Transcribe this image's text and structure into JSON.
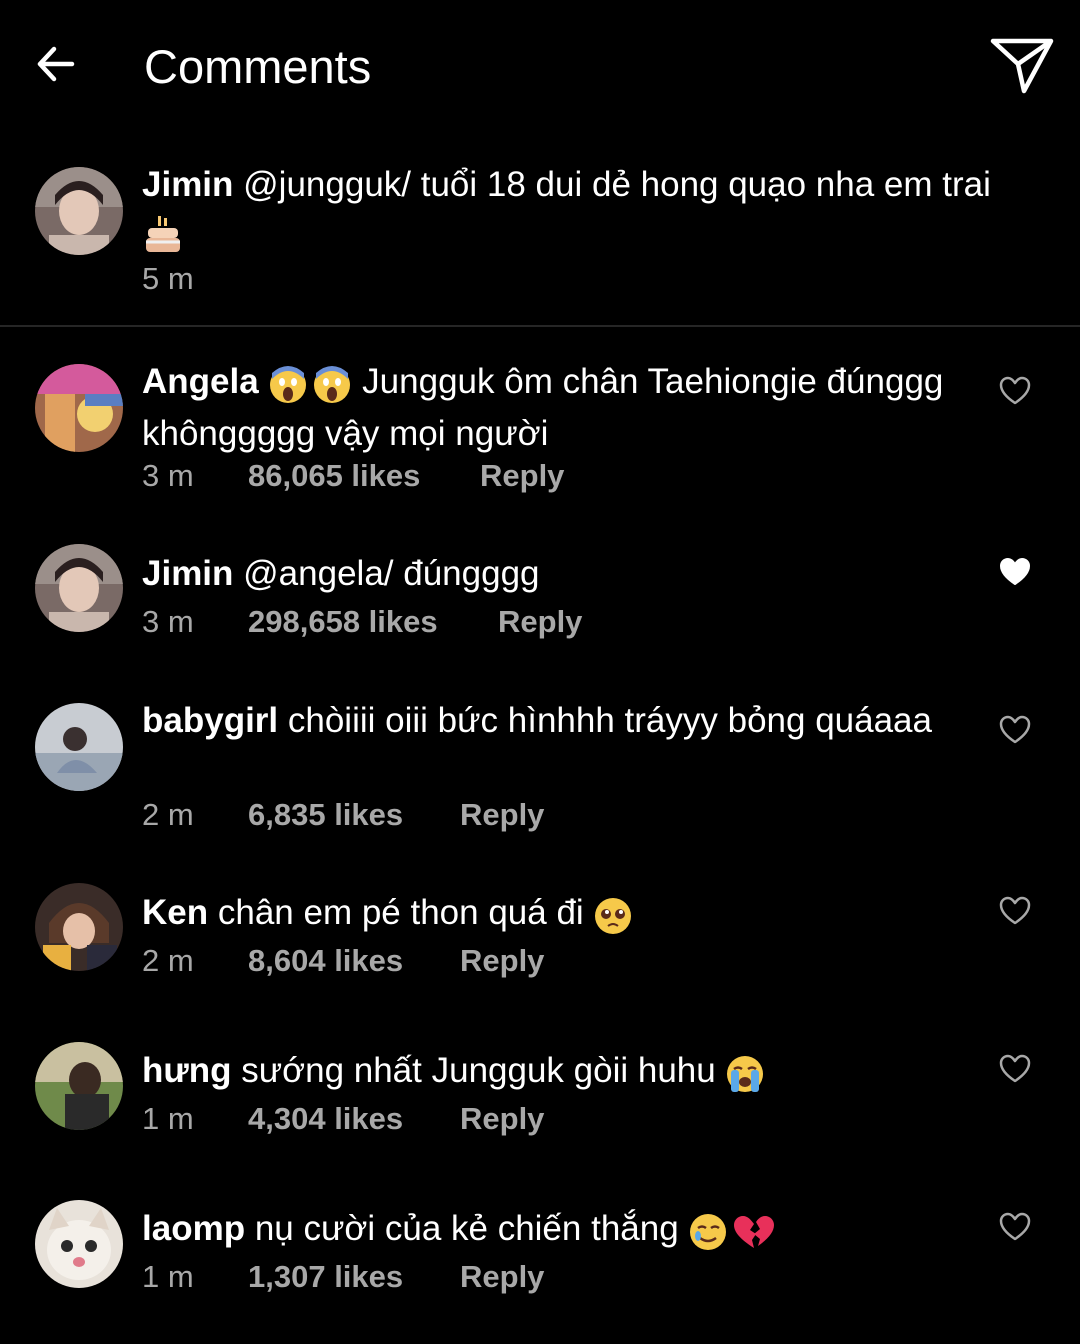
{
  "header": {
    "title": "Comments",
    "back_icon": "arrow-left-icon",
    "send_icon": "paper-plane-icon"
  },
  "caption": {
    "username": "Jimin",
    "text": "@jungguk/ tuổi 18 dui dẻ hong quạo nha em trai",
    "emoji": "🎂",
    "time": "5 m"
  },
  "comments": [
    {
      "username": "Angela",
      "lead_emoji": "😱😱",
      "text": "Jungguk ôm chân Taehiongie đúnggg khônggggg vậy mọi người",
      "time": "3 m",
      "likes": "86,065 likes",
      "reply": "Reply",
      "liked": false
    },
    {
      "username": "Jimin",
      "text": "@angela/ đúngggg",
      "time": "3 m",
      "likes": "298,658 likes",
      "reply": "Reply",
      "liked": true
    },
    {
      "username": "babygirl",
      "text": "chòiiii oiii bức hìnhhh tráyyy bỏng quáaaa",
      "time": "2 m",
      "likes": "6,835 likes",
      "reply": "Reply",
      "liked": false
    },
    {
      "username": "Ken",
      "text": "chân em pé thon quá đi",
      "trail_emoji": "🥺",
      "time": "2 m",
      "likes": "8,604 likes",
      "reply": "Reply",
      "liked": false
    },
    {
      "username": "hưng",
      "text": "sướng nhất Jungguk gòii huhu",
      "trail_emoji": "😭",
      "time": "1 m",
      "likes": "4,304 likes",
      "reply": "Reply",
      "liked": false
    },
    {
      "username": "laomp",
      "text": "nụ cười của kẻ chiến thắng",
      "trail_emoji": "🥲💔",
      "time": "1 m",
      "likes": "1,307 likes",
      "reply": "Reply",
      "liked": false
    }
  ],
  "colors": {
    "background": "#000000",
    "text": "#ffffff",
    "meta": "#a8a8a8",
    "divider": "#262626"
  }
}
